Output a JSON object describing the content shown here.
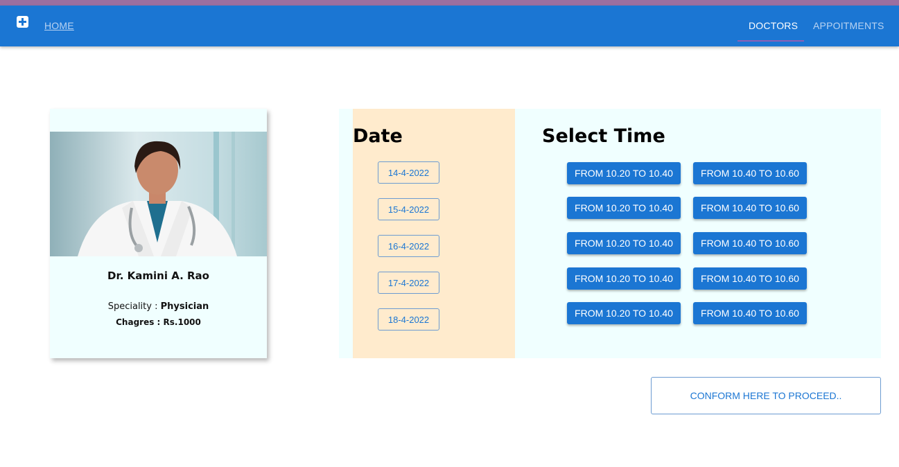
{
  "nav": {
    "home_label": "HOME",
    "tabs": [
      {
        "label": "DOCTORS",
        "active": true
      },
      {
        "label": "APPOITMENTS",
        "active": false
      }
    ],
    "logo_icon": "medical-cross-icon",
    "color_appbar": "#1b76d3",
    "color_indicator": "#8e5fb5"
  },
  "doctor": {
    "name": "Dr. Kamini A. Rao",
    "speciality_label": "Speciality :",
    "speciality": "Physician",
    "charges_label": "Chagres :",
    "charges": "Rs.1000"
  },
  "dates": {
    "title": "Date",
    "items": [
      "14-4-2022",
      "15-4-2022",
      "16-4-2022",
      "17-4-2022",
      "18-4-2022"
    ]
  },
  "times": {
    "title": "Select Time",
    "rows": [
      [
        "FROM 10.20 TO 10.40",
        "FROM 10.40 TO 10.60"
      ],
      [
        "FROM 10.20 TO 10.40",
        "FROM 10.40 TO 10.60"
      ],
      [
        "FROM 10.20 TO 10.40",
        "FROM 10.40 TO 10.60"
      ],
      [
        "FROM 10.20 TO 10.40",
        "FROM 10.40 TO 10.60"
      ],
      [
        "FROM 10.20 TO 10.40",
        "FROM 10.40 TO 10.60"
      ]
    ]
  },
  "confirm_label": "CONFORM HERE TO PROCEED.."
}
